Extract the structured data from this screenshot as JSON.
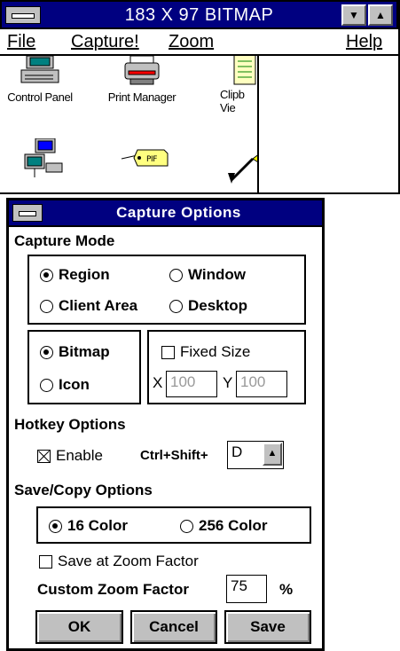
{
  "bitmap_window": {
    "title": "183 X 97 BITMAP",
    "minimize_glyph": "▼",
    "maximize_glyph": "▲",
    "menu": {
      "file": "File",
      "capture": "Capture!",
      "zoom": "Zoom",
      "help": "Help"
    },
    "icons": [
      {
        "name": "control-panel-icon",
        "label": "Control Panel"
      },
      {
        "name": "print-manager-icon",
        "label": "Print Manager"
      },
      {
        "name": "clipboard-viewer-icon",
        "label": "Clipb Vie"
      },
      {
        "name": "network-icon",
        "label": ""
      },
      {
        "name": "pif-editor-icon",
        "label": ""
      },
      {
        "name": "paintbrush-icon",
        "label": ""
      }
    ]
  },
  "dialog": {
    "title": "Capture Options",
    "capture_mode": {
      "label": "Capture Mode",
      "region": "Region",
      "window": "Window",
      "client_area": "Client Area",
      "desktop": "Desktop",
      "selected": "Region"
    },
    "format": {
      "bitmap": "Bitmap",
      "icon": "Icon",
      "selected": "Bitmap"
    },
    "fixed_size": {
      "label": "Fixed Size",
      "checked": false,
      "x_label": "X",
      "x_value": "100",
      "y_label": "Y",
      "y_value": "100"
    },
    "hotkey": {
      "label": "Hotkey Options",
      "enable": "Enable",
      "enabled": true,
      "modifier": "Ctrl+Shift+",
      "key": "D"
    },
    "save_copy": {
      "label": "Save/Copy Options",
      "color16": "16 Color",
      "color256": "256 Color",
      "selected": "16 Color",
      "save_at_zoom": "Save at Zoom Factor",
      "save_at_zoom_checked": false,
      "custom_zoom_label": "Custom Zoom Factor",
      "custom_zoom_value": "75",
      "percent": "%"
    },
    "buttons": {
      "ok": "OK",
      "cancel": "Cancel",
      "save": "Save"
    }
  }
}
